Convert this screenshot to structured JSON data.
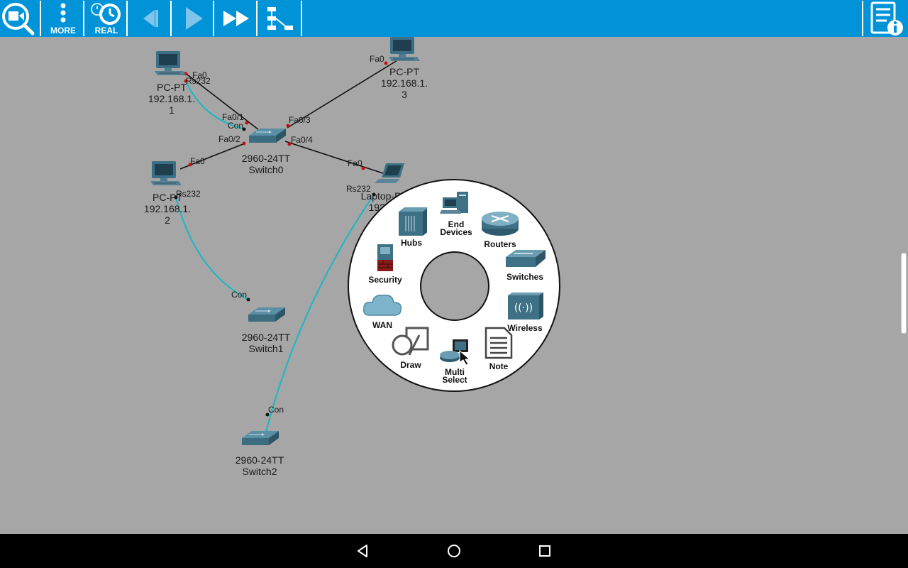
{
  "toolbar": {
    "more_label": "MORE",
    "real_label": "REAL"
  },
  "devices": {
    "pc1": {
      "name": "PC-PT",
      "ip": "192.168.1.",
      "ip2": "1"
    },
    "pc2": {
      "name": "PC-PT",
      "ip": "192.168.1.",
      "ip2": "2"
    },
    "pc3": {
      "name": "PC-PT",
      "ip": "192.168.1.",
      "ip2": "3"
    },
    "laptop": {
      "name": "Laptop-P",
      "ip": "192.1"
    },
    "switch0": {
      "model": "2960-24TT",
      "name": "Switch0"
    },
    "switch1": {
      "model": "2960-24TT",
      "name": "Switch1"
    },
    "switch2": {
      "model": "2960-24TT",
      "name": "Switch2"
    }
  },
  "ports": {
    "pc1_fa0": "Fa0",
    "pc1_rs232": "Rs232",
    "pc3_fa0": "Fa0",
    "sw0_fa01": "Fa0/1",
    "sw0_con": "Con",
    "sw0_fa03": "Fa0/3",
    "sw0_fa02": "Fa0/2",
    "sw0_fa04": "Fa0/4",
    "pc2_fa0": "Fa0",
    "pc2_rs232": "Rs232",
    "laptop_fa0": "Fa0",
    "laptop_rs232": "Rs232",
    "sw1_con": "Con",
    "sw2_con": "Con"
  },
  "radial_menu": {
    "end_devices": "End Devices",
    "end_devices_l1": "End",
    "end_devices_l2": "Devices",
    "hubs": "Hubs",
    "routers": "Routers",
    "security": "Security",
    "switches": "Switches",
    "wan": "WAN",
    "wireless": "Wireless",
    "draw": "Draw",
    "multi_select_l1": "Multi",
    "multi_select_l2": "Select",
    "note": "Note"
  },
  "colors": {
    "toolbar_bg": "#0093d8",
    "workspace_bg": "#a6a6a6",
    "console_cable": "#19b8c4",
    "ethernet_cable": "#111111",
    "port_dot": "#c41010"
  }
}
